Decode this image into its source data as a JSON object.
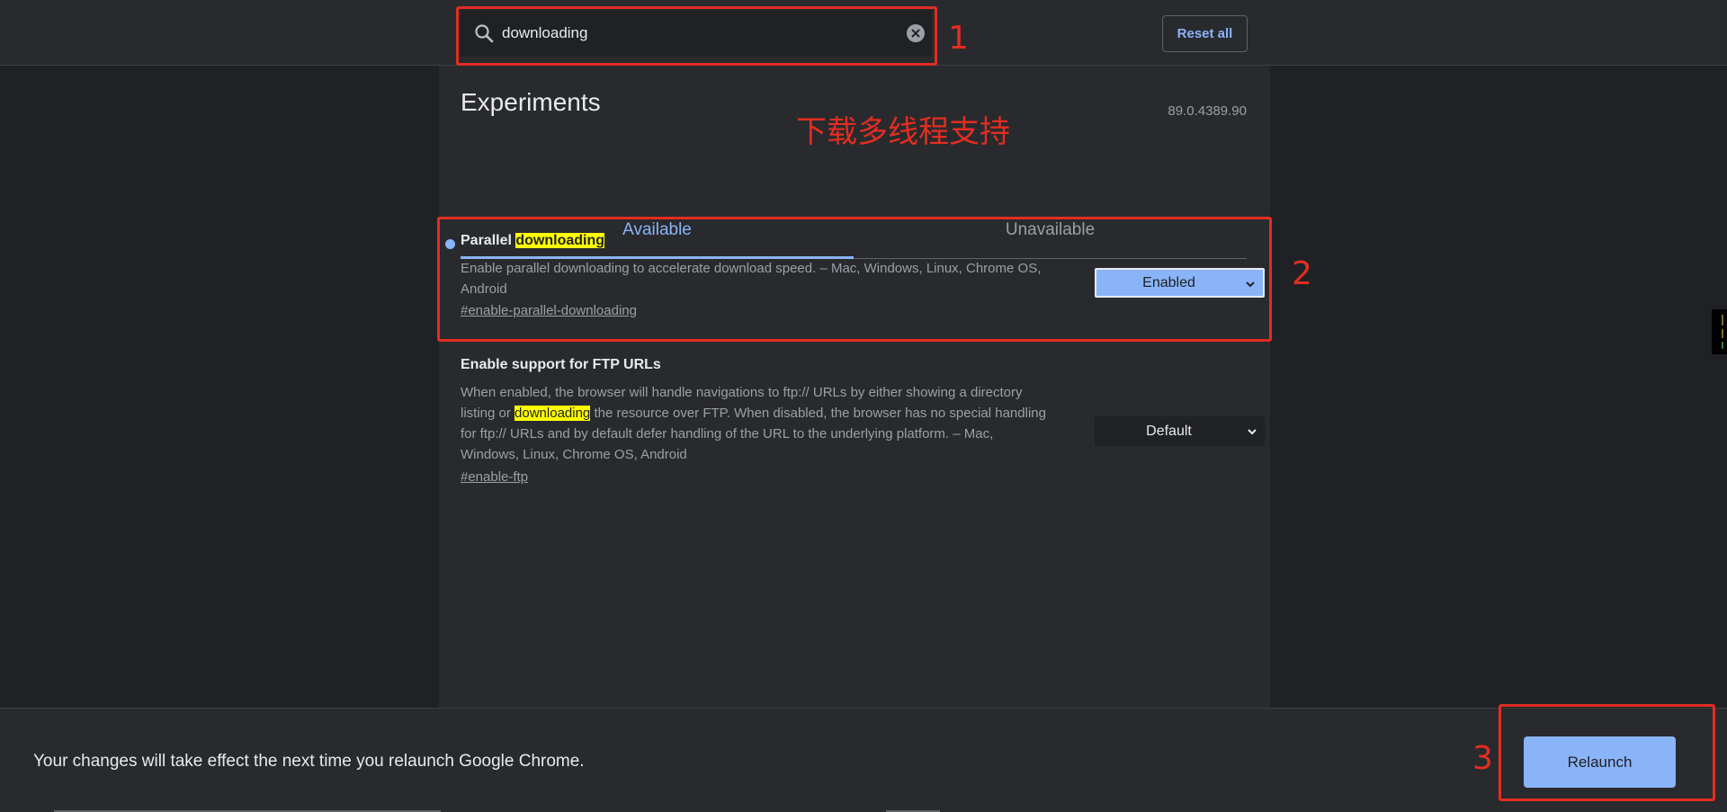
{
  "header": {
    "search_value": "downloading",
    "reset_label": "Reset all"
  },
  "page": {
    "title": "Experiments",
    "version": "89.0.4389.90"
  },
  "tabs": [
    {
      "label": "Available",
      "selected": true
    },
    {
      "label": "Unavailable",
      "selected": false
    }
  ],
  "experiments": [
    {
      "name_prefix": "Parallel ",
      "name_highlight": "downloading",
      "description": "Enable parallel downloading to accelerate download speed. – Mac, Windows, Linux, Chrome OS, Android",
      "link": "#enable-parallel-downloading",
      "select_value": "Enabled",
      "modified": true
    },
    {
      "name": "Enable support for FTP URLs",
      "description_before": "When enabled, the browser will handle navigations to ftp:// URLs by either showing a directory listing or ",
      "description_highlight": "downloading",
      "description_after": " the resource over FTP. When disabled, the browser has no special handling for ftp:// URLs and by default defer handling of the URL to the underlying platform. – Mac, Windows, Linux, Chrome OS, Android",
      "link": "#enable-ftp",
      "select_value": "Default"
    }
  ],
  "footer": {
    "message": "Your changes will take effect the next time you relaunch Google Chrome.",
    "relaunch_label": "Relaunch"
  },
  "annotations": {
    "label_1": "1",
    "label_2": "2",
    "label_3": "3",
    "note": "下载多线程支持"
  },
  "colors": {
    "background": "#202124",
    "panel": "#292a2d",
    "accent": "#8ab4f8",
    "highlight": "#ffff00",
    "annotation": "#e32d22"
  }
}
